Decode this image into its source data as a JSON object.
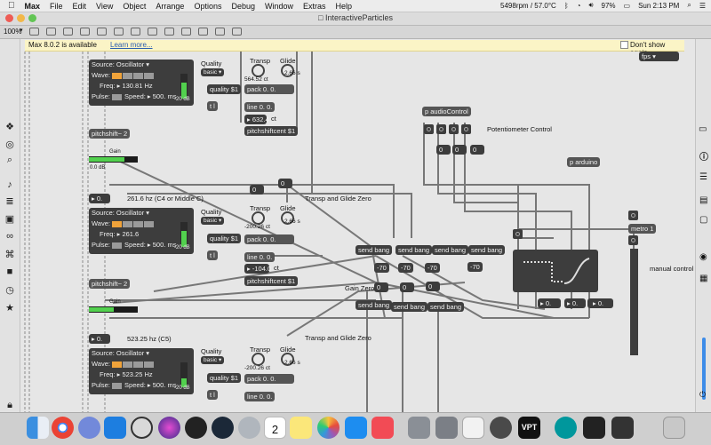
{
  "menubar": {
    "app": "Max",
    "items": [
      "File",
      "Edit",
      "View",
      "Object",
      "Arrange",
      "Options",
      "Debug",
      "Window",
      "Extras",
      "Help"
    ],
    "status": {
      "sensor": "5498rpm / 57.0°C",
      "battery": "97%",
      "clock": "Sun 2:13 PM"
    }
  },
  "window": {
    "title": "InteractiveParticles"
  },
  "toolbar": {
    "zoom": "100%"
  },
  "notification": {
    "message": "Max 8.0.2 is available",
    "link": "Learn more...",
    "dismiss": "Don't show again"
  },
  "patch": {
    "fps_menu": "fps",
    "voice1": {
      "source": "Source: Oscillator",
      "wave": "Wave:",
      "freq_label": "Freq:",
      "freq_value": "130.81 Hz",
      "pulse": "Pulse:",
      "speed": "Speed:",
      "speed_value": "500.",
      "ms": "ms",
      "db": "-20 dB",
      "quality_label": "Quality",
      "quality_menu": "basic",
      "quality_msg": "quality $1",
      "t_obj": "t l",
      "transp_label": "Transp",
      "transp_value": "564.52 ct",
      "glide_label": "Glide",
      "glide_value": "2.66 s",
      "pack": "pack 0. 0.",
      "line": "line 0. 0.",
      "cent_value": "632.4",
      "ct": "ct",
      "pitchcent": "pitchshiftcent $1",
      "pitchshift": "pitchshift~ 2",
      "gain_label": "Gain",
      "gain_db": "0.0 dB"
    },
    "voice2": {
      "num": "0.",
      "hz_comment": "261.6 hz (C4 or Middle C)",
      "transp_comment": "Transp and Glide Zero",
      "source": "Source: Oscillator",
      "wave": "Wave:",
      "freq_label": "Freq:",
      "freq_value": "261.6",
      "pulse": "Pulse:",
      "speed": "Speed:",
      "speed_value": "500.",
      "ms": "ms",
      "db": "-20 dB",
      "quality_label": "Quality",
      "quality_menu": "basic",
      "quality_msg": "quality $1",
      "t_obj": "t l",
      "transp_label": "Transp",
      "transp_value": "-200.26 ct",
      "glide_label": "Glide",
      "glide_value": "2.66 s",
      "pack": "pack 0. 0.",
      "line": "line 0. 0.",
      "cent_value": "-104.0",
      "ct": "ct",
      "pitchcent": "pitchshiftcent $1",
      "pitchshift": "pitchshift~ 2",
      "gain_label": "Gain",
      "gain_zero": "Gain Zero"
    },
    "voice3": {
      "num": "0.",
      "hz_comment": "523.25 hz (C5)",
      "transp_comment": "Transp and Glide Zero",
      "source": "Source: Oscillator",
      "wave": "Wave:",
      "freq_label": "Freq:",
      "freq_value": "523.25 Hz",
      "pulse": "Pulse:",
      "speed": "Speed:",
      "speed_value": "500.",
      "ms": "ms",
      "db": "-20 dB",
      "quality_label": "Quality",
      "quality_menu": "basic",
      "quality_msg": "quality $1",
      "t_obj": "t l",
      "transp_label": "Transp",
      "transp_value": "-200.26 ct",
      "glide_label": "Glide",
      "glide_value": "2.66 s",
      "pack": "pack 0. 0.",
      "line": "line 0. 0."
    },
    "zero_nums": [
      "0",
      "0"
    ],
    "audio_control": "p audioControl",
    "pot_comment": "Potentiometer Control",
    "pot_nums": [
      "0",
      "0",
      "0"
    ],
    "arduino": "p arduino",
    "send_bang": "send bang",
    "neg70": "-70",
    "metro": "metro 1",
    "manual": "manual control",
    "row_nums": [
      "0",
      "0",
      "0"
    ],
    "out_nums": [
      "0.",
      "0.",
      "0.",
      "0."
    ]
  },
  "dock": {
    "icons": [
      "finder-icon",
      "chrome-icon",
      "discord-icon",
      "xcode-icon",
      "max-icon",
      "siri-icon",
      "dp-icon",
      "steam-icon",
      "launchpad-icon",
      "calendar-icon",
      "notes-icon",
      "photos-icon",
      "appstore-icon",
      "news-icon",
      "system-prefs-icon",
      "preview-icon",
      "textedit-icon",
      "quicktime-icon",
      "vpt-icon",
      "arduino-icon",
      "terminal-icon",
      "activity-icon",
      "trash-icon"
    ],
    "calendar_day": "2"
  }
}
